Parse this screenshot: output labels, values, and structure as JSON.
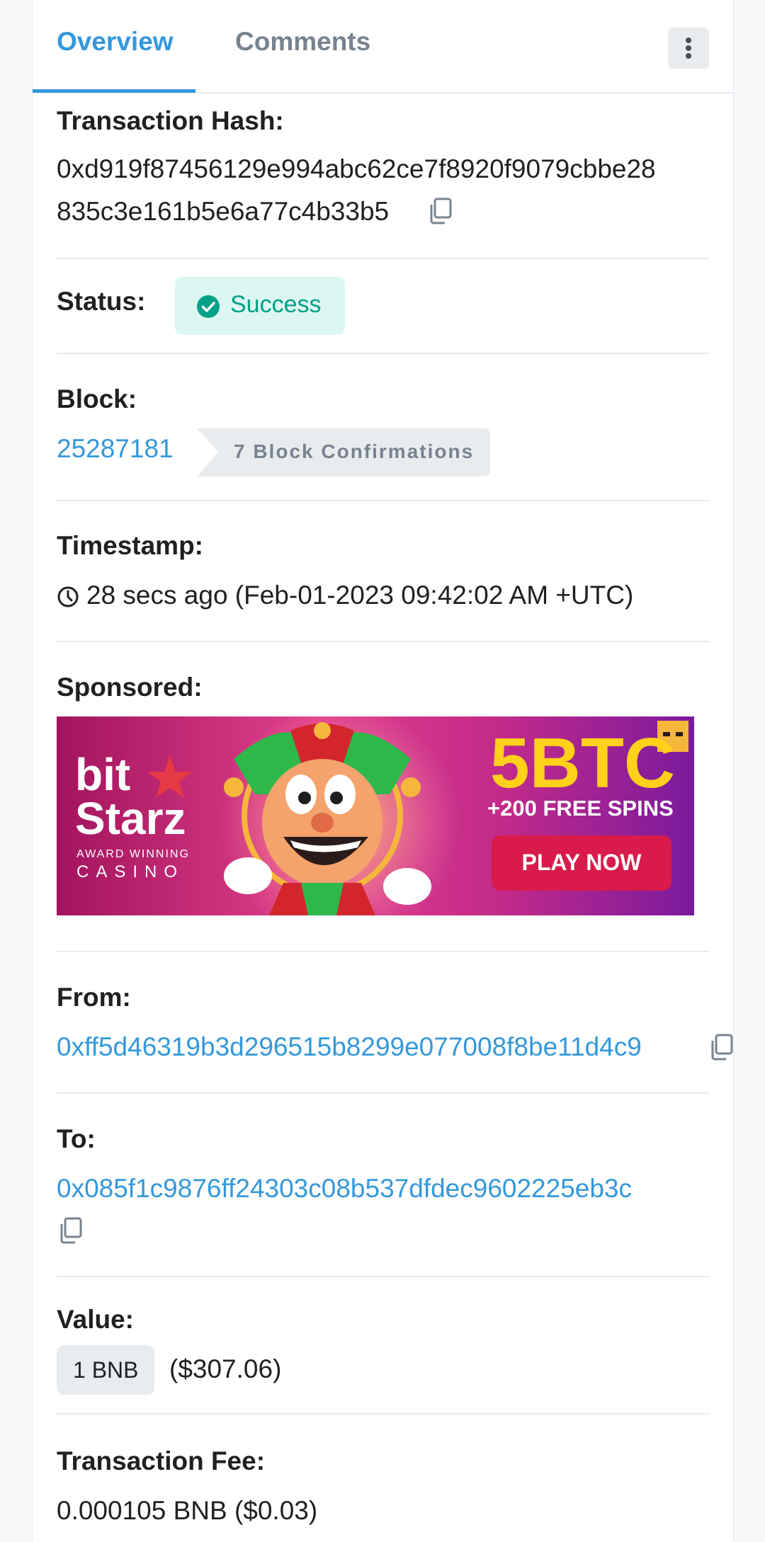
{
  "tabs": [
    {
      "label": "Overview",
      "active": true
    },
    {
      "label": "Comments",
      "active": false
    }
  ],
  "tx_hash": {
    "label": "Transaction Hash:",
    "line1": "0xd919f87456129e994abc62ce7f8920f9079cbbe28",
    "line2": "835c3e161b5e6a77c4b33b5"
  },
  "status": {
    "label": "Status:",
    "value": "Success",
    "color": "#00a186"
  },
  "block": {
    "label": "Block:",
    "number": "25287181",
    "confirmations": "7 Block Confirmations"
  },
  "timestamp": {
    "label": "Timestamp:",
    "value": "28 secs ago (Feb-01-2023 09:42:02 AM +UTC)"
  },
  "sponsored": {
    "label": "Sponsored:",
    "ad": {
      "brand_line1": "bit",
      "brand_line2": "Starz",
      "tagline1": "AWARD WINNING",
      "tagline2": "CASINO",
      "headline": "5BTC",
      "subheadline": "+200 FREE SPINS",
      "cta": "PLAY NOW"
    }
  },
  "from": {
    "label": "From:",
    "address": "0xff5d46319b3d296515b8299e077008f8be11d4c9"
  },
  "to": {
    "label": "To:",
    "address": "0x085f1c9876ff24303c08b537dfdec9602225eb3c"
  },
  "value": {
    "label": "Value:",
    "amount": "1 BNB",
    "usd": "($307.06)"
  },
  "fee": {
    "label": "Transaction Fee:",
    "value": "0.000105 BNB ($0.03)"
  },
  "colors": {
    "accent": "#3498db",
    "success": "#00a186",
    "text": "#1e2022",
    "muted": "#77838f"
  }
}
